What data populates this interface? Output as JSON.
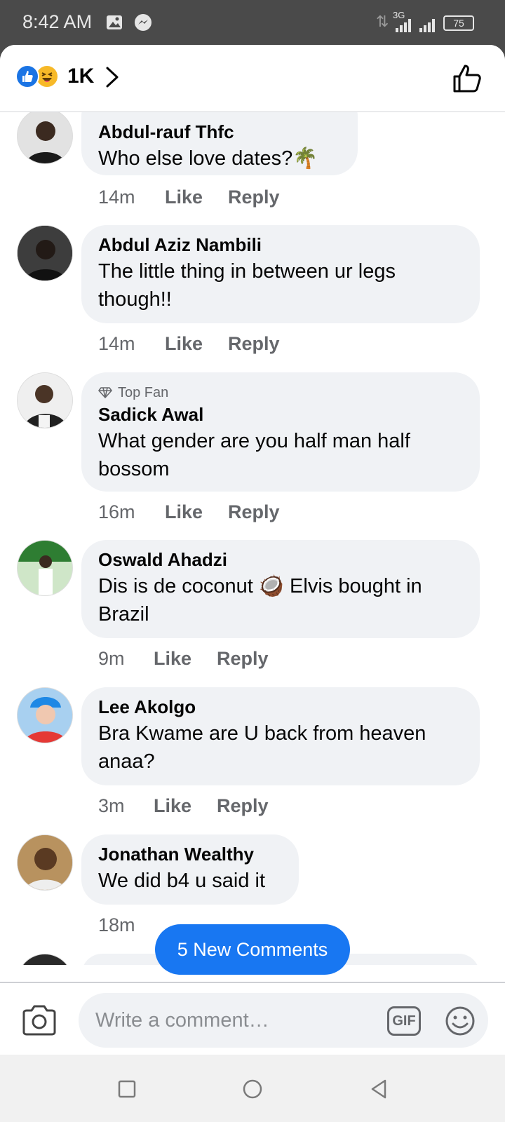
{
  "status_bar": {
    "time": "8:42 AM",
    "network": "3G",
    "battery": "75"
  },
  "header": {
    "reaction_count": "1K",
    "reactions": [
      "like-icon",
      "haha-icon"
    ]
  },
  "comments": [
    {
      "name": "Abdul-rauf Thfc",
      "text": "Who else love  dates?🌴",
      "time": "14m",
      "like": "Like",
      "reply": "Reply",
      "top_fan": ""
    },
    {
      "name": "Abdul Aziz Nambili",
      "text_lines": [
        "The little thing in between ur legs",
        "though!!"
      ],
      "time": "14m",
      "like": "Like",
      "reply": "Reply",
      "top_fan": ""
    },
    {
      "name": "Sadick Awal",
      "text_lines": [
        "What gender are you half man half",
        "bossom"
      ],
      "time": "16m",
      "like": "Like",
      "reply": "Reply",
      "top_fan": "Top Fan"
    },
    {
      "name": "Oswald Ahadzi",
      "text_lines": [
        "Dis is de coconut 🥥 Elvis bought in",
        "Brazil"
      ],
      "time": "9m",
      "like": "Like",
      "reply": "Reply",
      "top_fan": ""
    },
    {
      "name": "Lee Akolgo",
      "text_lines": [
        "Bra Kwame are U back from heaven",
        "anaa?"
      ],
      "time": "3m",
      "like": "Like",
      "reply": "Reply",
      "top_fan": ""
    },
    {
      "name": "Jonathan Wealthy",
      "text": "We did b4 u said it",
      "time": "18m",
      "like": "",
      "reply": "",
      "top_fan": ""
    }
  ],
  "new_comments_label": "5 New Comments",
  "composer": {
    "placeholder": "Write a comment…",
    "gif_label": "GIF"
  },
  "colors": {
    "accent": "#1877f2",
    "bubble": "#f0f2f5",
    "secondary_text": "#65676b"
  }
}
